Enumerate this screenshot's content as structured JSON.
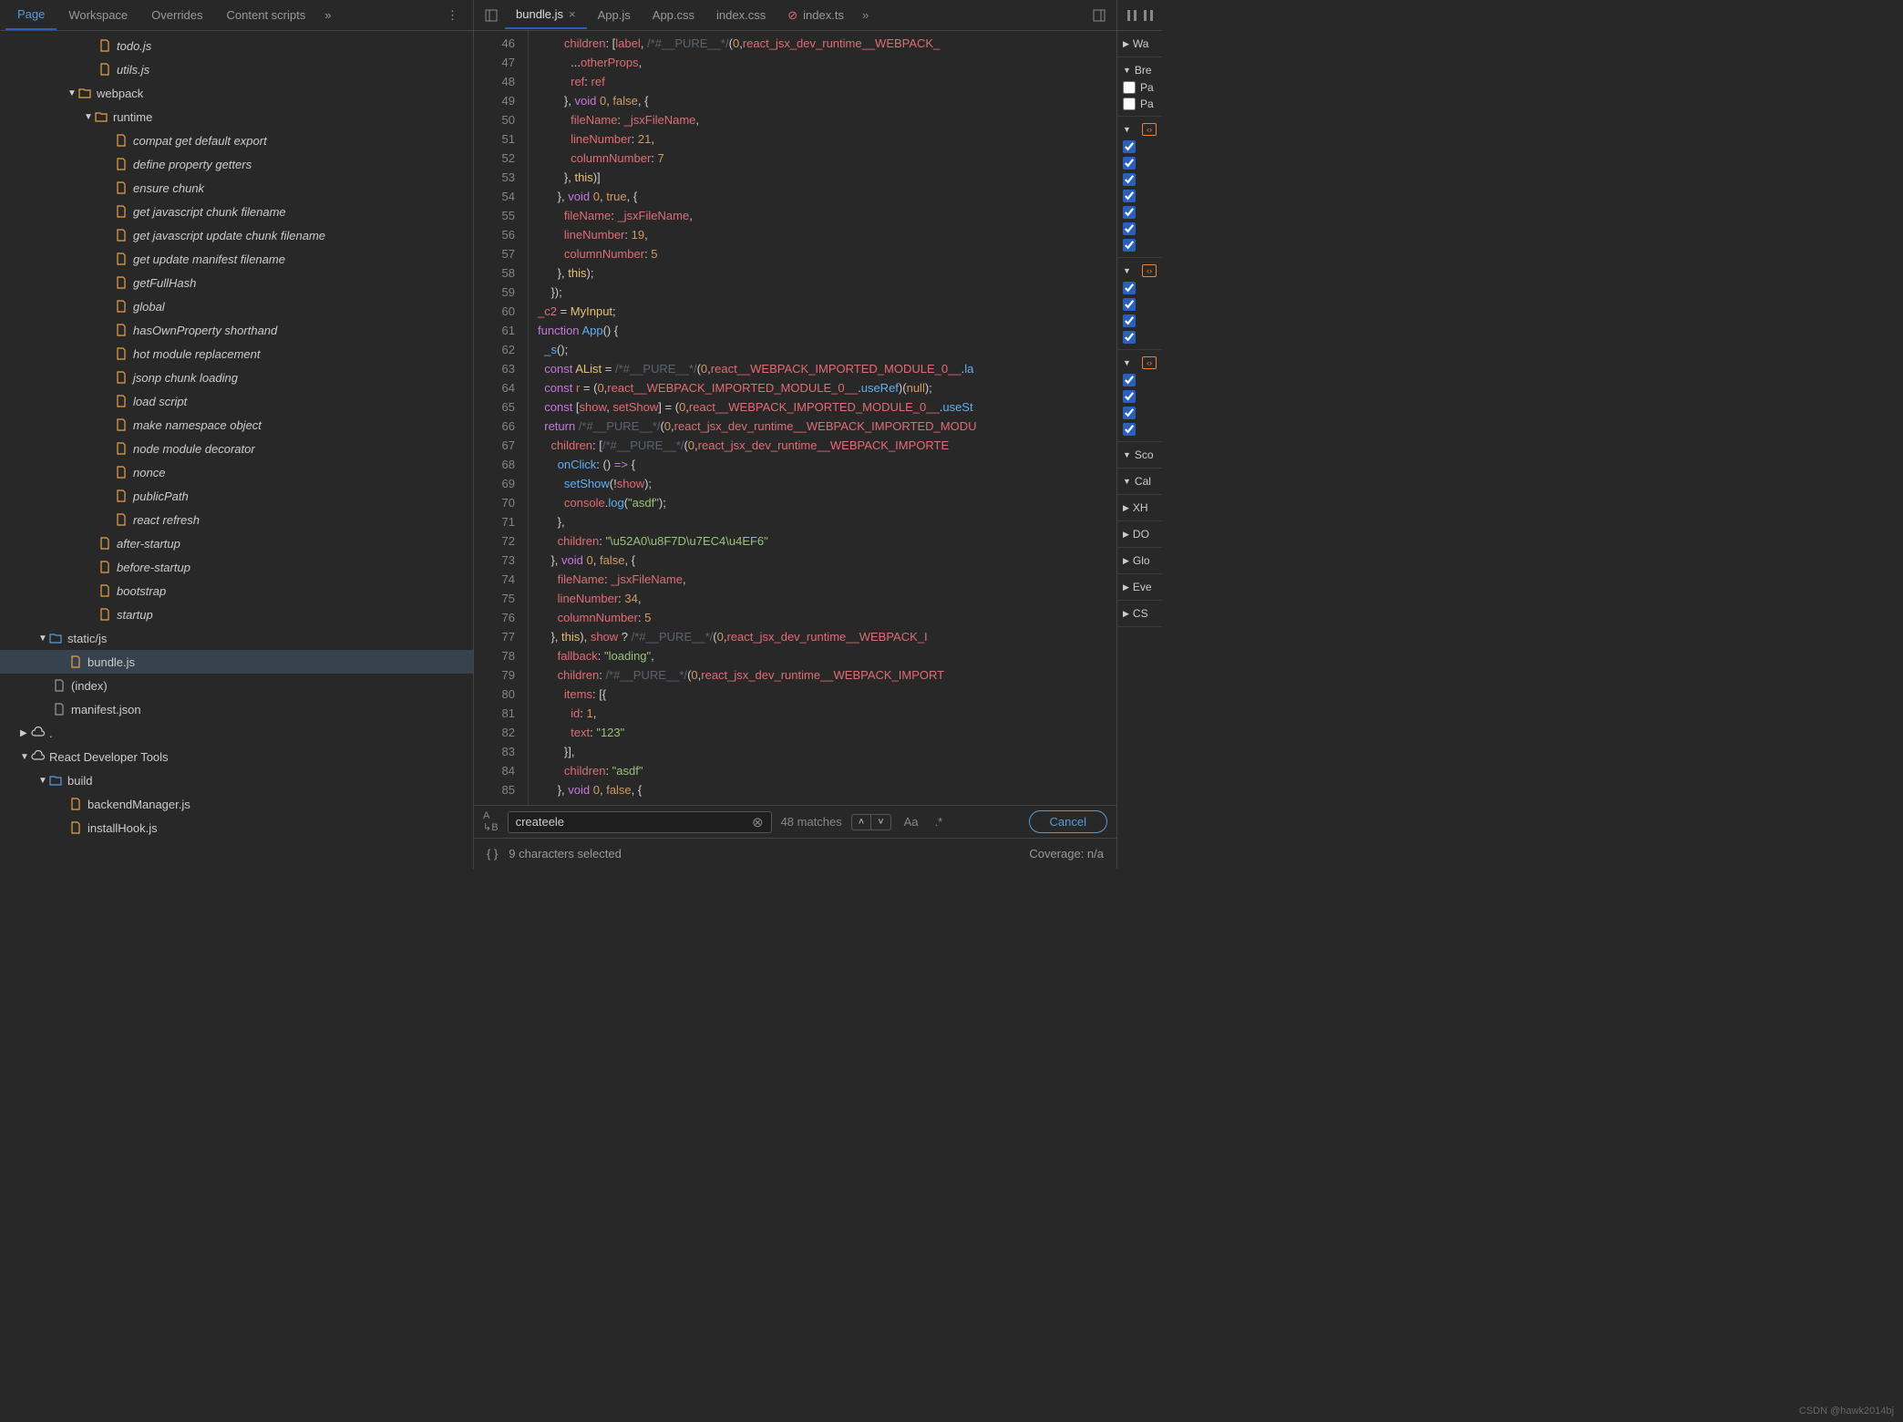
{
  "nav": {
    "tabs": [
      "Page",
      "Workspace",
      "Overrides",
      "Content scripts"
    ],
    "active": 0,
    "more": "»",
    "menu": "⋮"
  },
  "tree": [
    {
      "indent": 108,
      "icon": "file",
      "label": "todo.js",
      "italic": true
    },
    {
      "indent": 108,
      "icon": "file",
      "label": "utils.js",
      "italic": true
    },
    {
      "indent": 74,
      "arrow": "▼",
      "icon": "folder",
      "label": "webpack",
      "italic": false
    },
    {
      "indent": 92,
      "arrow": "▼",
      "icon": "folder",
      "label": "runtime",
      "italic": false
    },
    {
      "indent": 126,
      "icon": "file",
      "label": "compat get default export",
      "italic": true
    },
    {
      "indent": 126,
      "icon": "file",
      "label": "define property getters",
      "italic": true
    },
    {
      "indent": 126,
      "icon": "file",
      "label": "ensure chunk",
      "italic": true
    },
    {
      "indent": 126,
      "icon": "file",
      "label": "get javascript chunk filename",
      "italic": true
    },
    {
      "indent": 126,
      "icon": "file",
      "label": "get javascript update chunk filename",
      "italic": true
    },
    {
      "indent": 126,
      "icon": "file",
      "label": "get update manifest filename",
      "italic": true
    },
    {
      "indent": 126,
      "icon": "file",
      "label": "getFullHash",
      "italic": true
    },
    {
      "indent": 126,
      "icon": "file",
      "label": "global",
      "italic": true
    },
    {
      "indent": 126,
      "icon": "file",
      "label": "hasOwnProperty shorthand",
      "italic": true
    },
    {
      "indent": 126,
      "icon": "file",
      "label": "hot module replacement",
      "italic": true
    },
    {
      "indent": 126,
      "icon": "file",
      "label": "jsonp chunk loading",
      "italic": true
    },
    {
      "indent": 126,
      "icon": "file",
      "label": "load script",
      "italic": true
    },
    {
      "indent": 126,
      "icon": "file",
      "label": "make namespace object",
      "italic": true
    },
    {
      "indent": 126,
      "icon": "file",
      "label": "node module decorator",
      "italic": true
    },
    {
      "indent": 126,
      "icon": "file",
      "label": "nonce",
      "italic": true
    },
    {
      "indent": 126,
      "icon": "file",
      "label": "publicPath",
      "italic": true
    },
    {
      "indent": 126,
      "icon": "file",
      "label": "react refresh",
      "italic": true
    },
    {
      "indent": 108,
      "icon": "file",
      "label": "after-startup",
      "italic": true
    },
    {
      "indent": 108,
      "icon": "file",
      "label": "before-startup",
      "italic": true
    },
    {
      "indent": 108,
      "icon": "file",
      "label": "bootstrap",
      "italic": true
    },
    {
      "indent": 108,
      "icon": "file",
      "label": "startup",
      "italic": true
    },
    {
      "indent": 42,
      "arrow": "▼",
      "icon": "folder-blue",
      "label": "static/js",
      "italic": false
    },
    {
      "indent": 76,
      "icon": "file",
      "label": "bundle.js",
      "italic": false,
      "selected": true
    },
    {
      "indent": 58,
      "icon": "file-grey",
      "label": "(index)",
      "italic": false
    },
    {
      "indent": 58,
      "icon": "file-grey",
      "label": "manifest.json",
      "italic": false
    },
    {
      "indent": 22,
      "arrow": "▶",
      "icon": "cloud",
      "label": ".",
      "italic": false
    },
    {
      "indent": 22,
      "arrow": "▼",
      "icon": "cloud",
      "label": "React Developer Tools",
      "italic": false
    },
    {
      "indent": 42,
      "arrow": "▼",
      "icon": "folder-blue",
      "label": "build",
      "italic": false
    },
    {
      "indent": 76,
      "icon": "file",
      "label": "backendManager.js",
      "italic": false
    },
    {
      "indent": 76,
      "icon": "file",
      "label": "installHook.js",
      "italic": false
    }
  ],
  "editorTabs": [
    {
      "label": "bundle.js",
      "active": true,
      "close": true
    },
    {
      "label": "App.js"
    },
    {
      "label": "App.css"
    },
    {
      "label": "index.css"
    },
    {
      "label": "index.ts",
      "error": true
    }
  ],
  "editorMore": "»",
  "code": {
    "startLine": 46,
    "lines": [
      {
        "n": 46,
        "html": "        <span class='tok-prop'>children</span>: [<span class='tok-var'>label</span>, <span class='tok-comment'>/*#__PURE__*/</span>(<span class='tok-num'>0</span>,<span class='tok-var'>react_jsx_dev_runtime__WEBPACK_</span>"
      },
      {
        "n": 47,
        "html": "          ...<span class='tok-var'>otherProps</span>,"
      },
      {
        "n": 48,
        "html": "          <span class='tok-prop'>ref</span>: <span class='tok-var'>ref</span>"
      },
      {
        "n": 49,
        "html": "        }, <span class='tok-key'>void</span> <span class='tok-num'>0</span>, <span class='tok-bool'>false</span>, {"
      },
      {
        "n": 50,
        "html": "          <span class='tok-prop'>fileName</span>: <span class='tok-var'>_jsxFileName</span>,"
      },
      {
        "n": 51,
        "html": "          <span class='tok-prop'>lineNumber</span>: <span class='tok-num'>21</span>,"
      },
      {
        "n": 52,
        "html": "          <span class='tok-prop'>columnNumber</span>: <span class='tok-num'>7</span>"
      },
      {
        "n": 53,
        "html": "        }, <span class='tok-this'>this</span>)]"
      },
      {
        "n": 54,
        "html": "      }, <span class='tok-key'>void</span> <span class='tok-num'>0</span>, <span class='tok-bool'>true</span>, {"
      },
      {
        "n": 55,
        "html": "        <span class='tok-prop'>fileName</span>: <span class='tok-var'>_jsxFileName</span>,"
      },
      {
        "n": 56,
        "html": "        <span class='tok-prop'>lineNumber</span>: <span class='tok-num'>19</span>,"
      },
      {
        "n": 57,
        "html": "        <span class='tok-prop'>columnNumber</span>: <span class='tok-num'>5</span>"
      },
      {
        "n": 58,
        "html": "      }, <span class='tok-this'>this</span>);"
      },
      {
        "n": 59,
        "html": "    });"
      },
      {
        "n": 60,
        "html": "<span class='tok-var'>_c2</span> = <span class='tok-id'>MyInput</span>;"
      },
      {
        "n": 61,
        "html": "<span class='tok-key'>function</span> <span class='tok-fn'>App</span>() {"
      },
      {
        "n": 62,
        "html": "  <span class='tok-fn'>_s</span>();"
      },
      {
        "n": 63,
        "html": "  <span class='tok-key'>const</span> <span class='tok-id'>AList</span> = <span class='tok-comment'>/*#__PURE__*/</span>(<span class='tok-num'>0</span>,<span class='tok-var'>react__WEBPACK_IMPORTED_MODULE_0__</span>.<span class='tok-fn'>la</span>"
      },
      {
        "n": 64,
        "html": "  <span class='tok-key'>const</span> <span class='tok-var'>r</span> = (<span class='tok-num'>0</span>,<span class='tok-var'>react__WEBPACK_IMPORTED_MODULE_0__</span>.<span class='tok-fn'>useRef</span>)(<span class='tok-bool'>null</span>);"
      },
      {
        "n": 65,
        "html": "  <span class='tok-key'>const</span> [<span class='tok-var'>show</span>, <span class='tok-var'>setShow</span>] = (<span class='tok-num'>0</span>,<span class='tok-var'>react__WEBPACK_IMPORTED_MODULE_0__</span>.<span class='tok-fn'>useSt</span>"
      },
      {
        "n": 66,
        "html": "  <span class='tok-key'>return</span> <span class='tok-comment'>/*#__PURE__*/</span>(<span class='tok-num'>0</span>,<span class='tok-var'>react_jsx_dev_runtime__WEBPACK_IMPORTED_MODU</span>"
      },
      {
        "n": 67,
        "html": "    <span class='tok-prop'>children</span>: [<span class='tok-comment'>/*#__PURE__*/</span>(<span class='tok-num'>0</span>,<span class='tok-var'>react_jsx_dev_runtime__WEBPACK_IMPORTE</span>"
      },
      {
        "n": 68,
        "html": "      <span class='tok-fn'>onClick</span>: () <span class='tok-key'>=></span> {"
      },
      {
        "n": 69,
        "html": "        <span class='tok-fn'>setShow</span>(!<span class='tok-var'>show</span>);"
      },
      {
        "n": 70,
        "html": "        <span class='tok-var'>console</span>.<span class='tok-fn'>log</span>(<span class='tok-str'>\"asdf\"</span>);"
      },
      {
        "n": 71,
        "html": "      },"
      },
      {
        "n": 72,
        "html": "      <span class='tok-prop'>children</span>: <span class='tok-str'>\"\\u52A0\\u8F7D\\u7EC4\\u4EF6\"</span>"
      },
      {
        "n": 73,
        "html": "    }, <span class='tok-key'>void</span> <span class='tok-num'>0</span>, <span class='tok-bool'>false</span>, {"
      },
      {
        "n": 74,
        "html": "      <span class='tok-prop'>fileName</span>: <span class='tok-var'>_jsxFileName</span>,"
      },
      {
        "n": 75,
        "html": "      <span class='tok-prop'>lineNumber</span>: <span class='tok-num'>34</span>,"
      },
      {
        "n": 76,
        "html": "      <span class='tok-prop'>columnNumber</span>: <span class='tok-num'>5</span>"
      },
      {
        "n": 77,
        "html": "    }, <span class='tok-this'>this</span>), <span class='tok-var'>show</span> ? <span class='tok-comment'>/*#__PURE__*/</span>(<span class='tok-num'>0</span>,<span class='tok-var'>react_jsx_dev_runtime__WEBPACK_I</span>"
      },
      {
        "n": 78,
        "html": "      <span class='tok-prop'>fallback</span>: <span class='tok-str'>\"loading\"</span>,"
      },
      {
        "n": 79,
        "html": "      <span class='tok-prop'>children</span>: <span class='tok-comment'>/*#__PURE__*/</span>(<span class='tok-num'>0</span>,<span class='tok-var'>react_jsx_dev_runtime__WEBPACK_IMPORT</span>"
      },
      {
        "n": 80,
        "html": "        <span class='tok-prop'>items</span>: [{"
      },
      {
        "n": 81,
        "html": "          <span class='tok-prop'>id</span>: <span class='tok-num'>1</span>,"
      },
      {
        "n": 82,
        "html": "          <span class='tok-prop'>text</span>: <span class='tok-str'>\"123\"</span>"
      },
      {
        "n": 83,
        "html": "        }],"
      },
      {
        "n": 84,
        "html": "        <span class='tok-prop'>children</span>: <span class='tok-str'>\"asdf\"</span>"
      },
      {
        "n": 85,
        "html": "      }, <span class='tok-key'>void</span> <span class='tok-num'>0</span>, <span class='tok-bool'>false</span>, {"
      }
    ]
  },
  "search": {
    "value": "createele",
    "matches": "48 matches",
    "cancel": "Cancel",
    "aa": "Aa",
    "regex": ".*"
  },
  "status": {
    "selected": "9 characters selected",
    "coverage": "Coverage: n/a"
  },
  "rightPanel": {
    "sections": [
      {
        "title": "Wa",
        "arrow": "▶"
      },
      {
        "title": "Bre",
        "arrow": "▼",
        "checks": [
          {
            "label": "Pa",
            "checked": false
          },
          {
            "label": "Pa",
            "checked": false
          }
        ]
      },
      {
        "arrow": "▼",
        "badge": "‹›",
        "checks": [
          {
            "checked": true
          },
          {
            "checked": true
          },
          {
            "checked": true
          },
          {
            "checked": true
          },
          {
            "checked": true
          },
          {
            "checked": true
          },
          {
            "checked": true
          }
        ]
      },
      {
        "arrow": "▼",
        "badge": "‹›",
        "checks": [
          {
            "checked": true
          },
          {
            "checked": true
          },
          {
            "checked": true
          },
          {
            "checked": true
          }
        ]
      },
      {
        "arrow": "▼",
        "badge": "‹›",
        "checks": [
          {
            "checked": true
          },
          {
            "checked": true
          },
          {
            "checked": true
          },
          {
            "checked": true
          }
        ]
      },
      {
        "title": "Sco",
        "arrow": "▼"
      },
      {
        "title": "Cal",
        "arrow": "▼"
      },
      {
        "title": "XH",
        "arrow": "▶"
      },
      {
        "title": "DO",
        "arrow": "▶"
      },
      {
        "title": "Glo",
        "arrow": "▶"
      },
      {
        "title": "Eve",
        "arrow": "▶"
      },
      {
        "title": "CS",
        "arrow": "▶"
      }
    ]
  },
  "watermark": "CSDN @hawk2014bj"
}
